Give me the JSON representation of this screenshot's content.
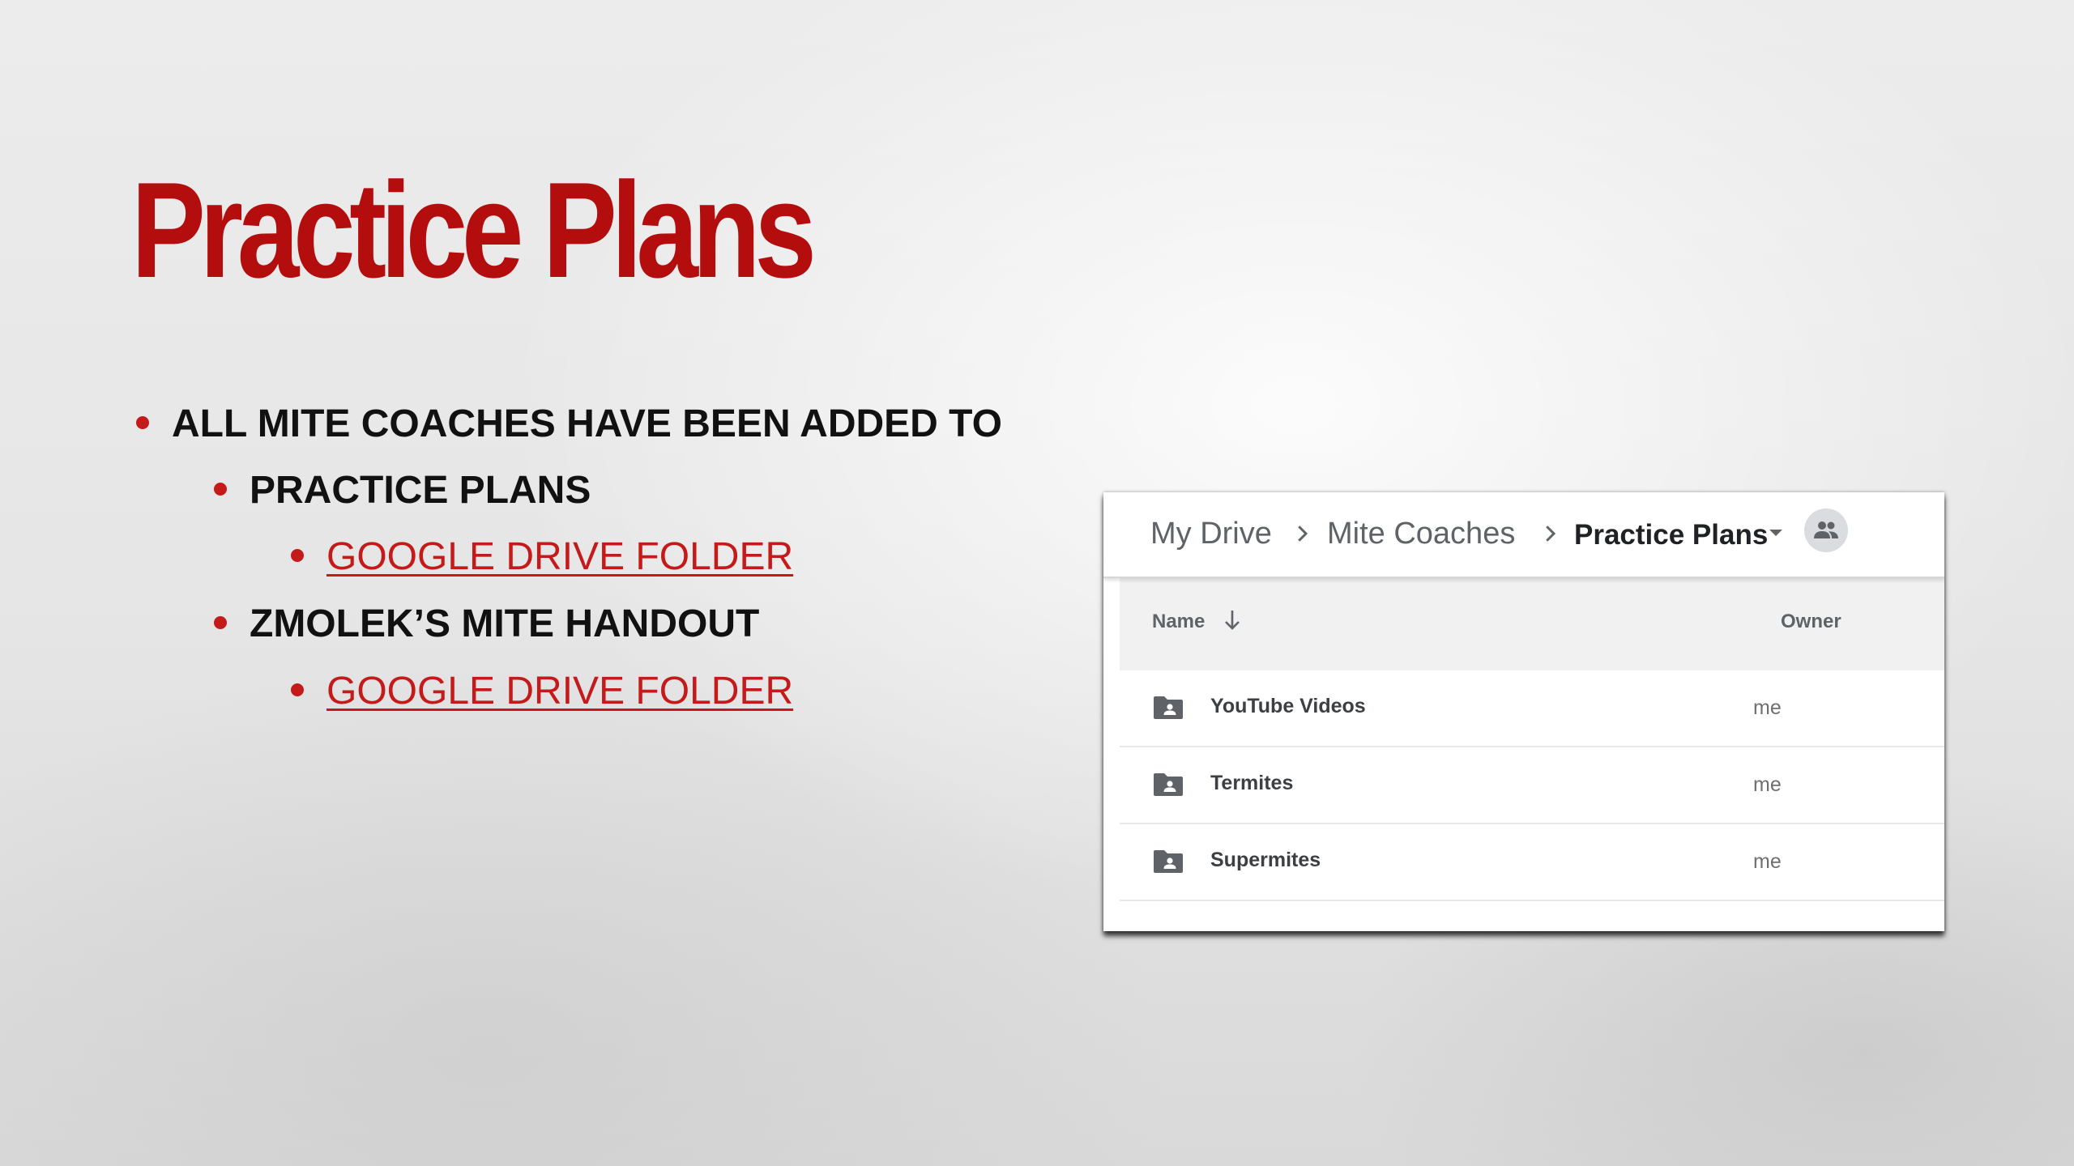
{
  "slide": {
    "title": "Practice Plans",
    "bullets": [
      {
        "level": 1,
        "text": "All Mite Coaches have been added to"
      },
      {
        "level": 2,
        "text": "Practice Plans"
      },
      {
        "level": 3,
        "text": "Google Drive Folder",
        "is_link": true
      },
      {
        "level": 2,
        "text": "Zmolek’s Mite Handout"
      },
      {
        "level": 3,
        "text": "Google Drive Folder",
        "is_link": true
      }
    ]
  },
  "drive": {
    "breadcrumb": [
      "My Drive",
      "Mite Coaches",
      "Practice Plans"
    ],
    "columns": {
      "name": "Name",
      "owner": "Owner"
    },
    "rows": [
      {
        "name": "YouTube Videos",
        "owner": "me",
        "icon": "shared-folder-icon"
      },
      {
        "name": "Termites",
        "owner": "me",
        "icon": "shared-folder-icon"
      },
      {
        "name": "Supermites",
        "owner": "me",
        "icon": "shared-folder-icon"
      }
    ]
  },
  "colors": {
    "title_red": "#b30d0d",
    "link_red": "#c41a1a",
    "bullet_red": "#c41a1a",
    "text_dark": "#111111",
    "drive_header_bg": "#f1f1f1",
    "drive_icon_gray": "#5f6368"
  }
}
